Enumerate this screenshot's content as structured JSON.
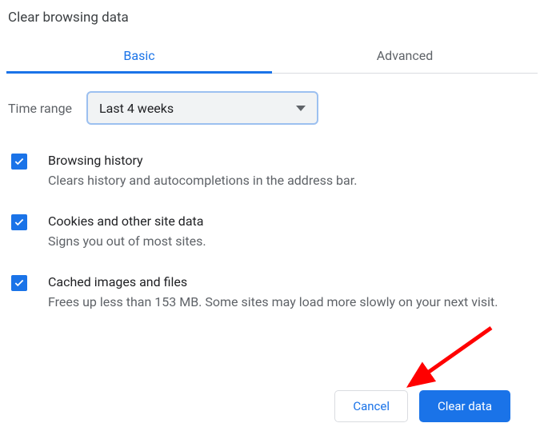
{
  "title": "Clear browsing data",
  "tabs": {
    "basic": "Basic",
    "advanced": "Advanced"
  },
  "time": {
    "label": "Time range",
    "value": "Last 4 weeks"
  },
  "items": [
    {
      "title": "Browsing history",
      "desc": "Clears history and autocompletions in the address bar.",
      "checked": true
    },
    {
      "title": "Cookies and other site data",
      "desc": "Signs you out of most sites.",
      "checked": true
    },
    {
      "title": "Cached images and files",
      "desc": "Frees up less than 153 MB. Some sites may load more slowly on your next visit.",
      "checked": true
    }
  ],
  "buttons": {
    "cancel": "Cancel",
    "clear": "Clear data"
  },
  "colors": {
    "accent": "#1a73e8",
    "muted": "#5f6368",
    "arrow": "#ff0000"
  }
}
